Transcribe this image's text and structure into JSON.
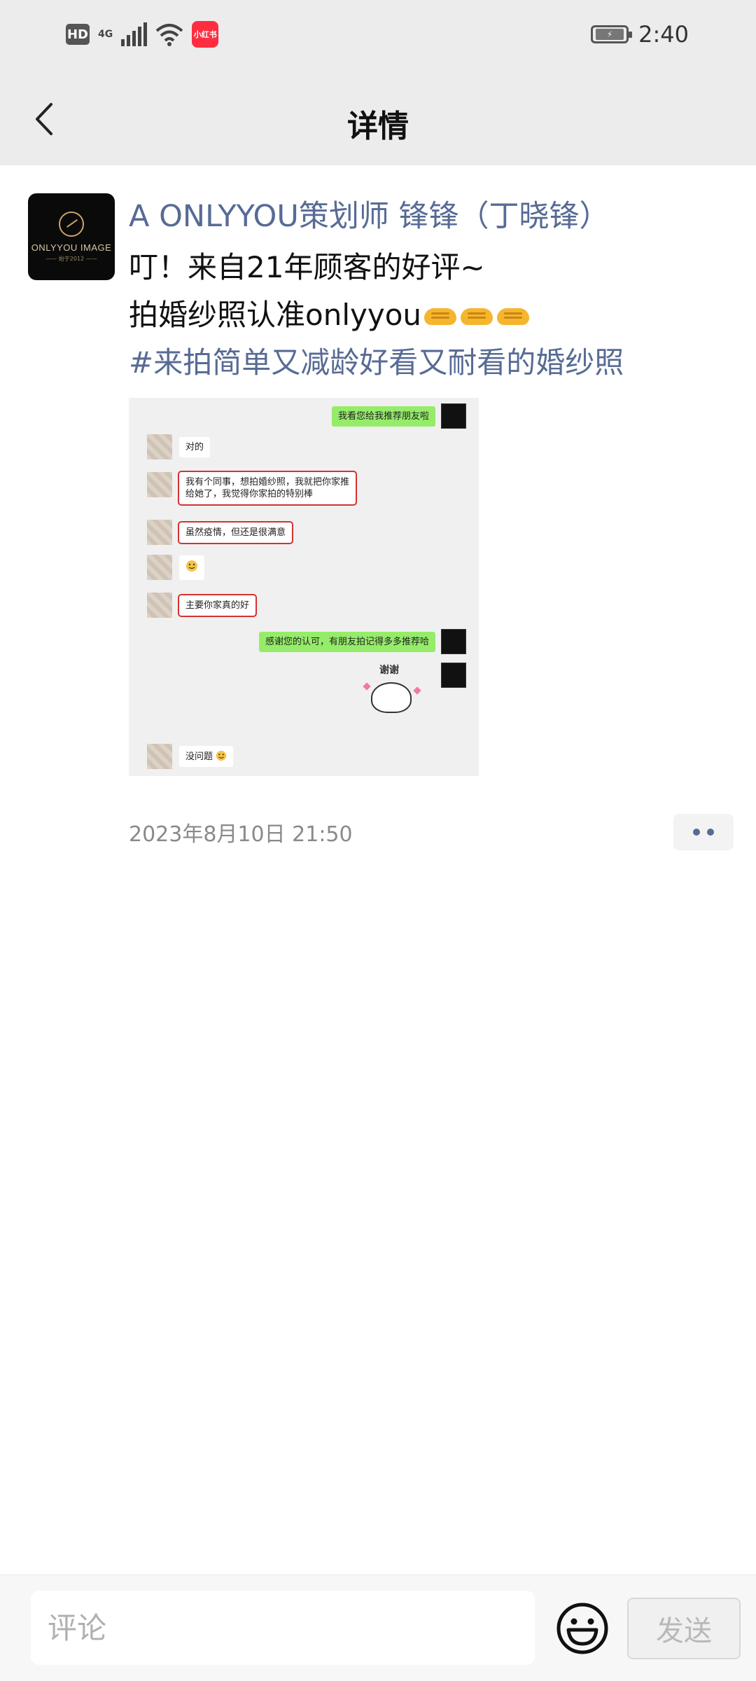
{
  "status_bar": {
    "hd_label": "HD",
    "network_label": "4G",
    "app_badge": "小红书",
    "time": "2:40"
  },
  "nav": {
    "title": "详情"
  },
  "post": {
    "author": "A ONLYYOU策划师 锋锋（丁晓锋）",
    "avatar_logo_text": "ONLYYOU IMAGE",
    "avatar_logo_sub": "—— 始于2012 ——",
    "line1": "叮！来自21年顾客的好评~",
    "line2": "拍婚纱照认准onlyyou",
    "hashtag": "#来拍简单又减龄好看又耐看的婚纱照",
    "timestamp": "2023年8月10日 21:50",
    "image": {
      "msg_sent_1": "我看您给我推荐朋友啦",
      "msg_recv_1": "对的",
      "msg_recv_2a": "我有个同事，想拍婚纱照，我就把你家推",
      "msg_recv_2b": "给她了，我觉得你家拍的特别棒",
      "msg_recv_3": "虽然疫情，但还是很满意",
      "msg_recv_5": "主要你家真的好",
      "msg_sent_2": "感谢您的认可，有朋友拍记得多多推荐哈",
      "sticker_text": "谢谢",
      "msg_recv_6": "没问题"
    }
  },
  "comment_bar": {
    "placeholder": "评论",
    "send_label": "发送"
  },
  "colors": {
    "link_blue": "#576b95",
    "chat_green": "#95ec69",
    "highlight_red": "#d23333"
  }
}
